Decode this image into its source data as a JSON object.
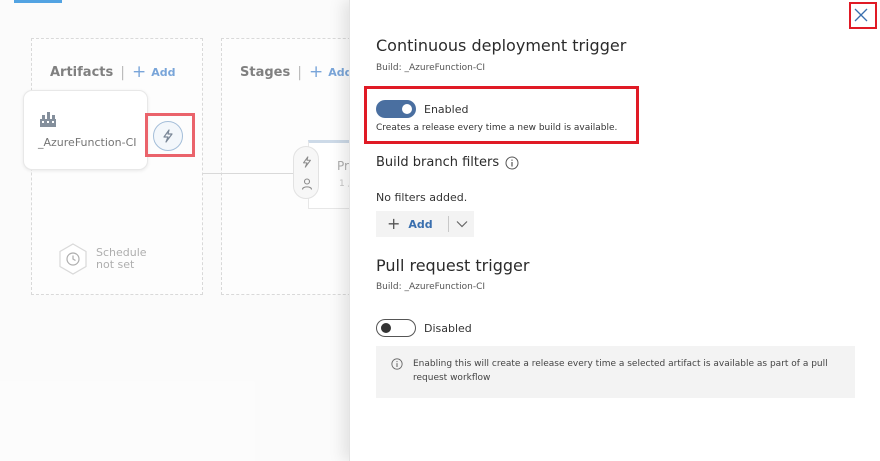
{
  "canvas": {
    "artifacts_label": "Artifacts",
    "add_label": "Add",
    "stages_label": "Stages",
    "stages_add_label": "Add",
    "artifact_name": "_AzureFunction-CI",
    "schedule_label_line1": "Schedule",
    "schedule_label_line2": "not set",
    "stage_name_partial": "Pr",
    "stage_sub_partial": "1 ,"
  },
  "panel": {
    "cd_title": "Continuous deployment trigger",
    "cd_build": "Build: _AzureFunction-CI",
    "cd_toggle_state": "on",
    "cd_toggle_label": "Enabled",
    "cd_description": "Creates a release every time a new build is available.",
    "branch_filters_title": "Build branch filters",
    "no_filters": "No filters added.",
    "add_button_label": "Add",
    "pr_title": "Pull request trigger",
    "pr_build": "Build: _AzureFunction-CI",
    "pr_toggle_state": "off",
    "pr_toggle_label": "Disabled",
    "pr_notice": "Enabling this will create a release every time a selected artifact is available as part of a pull request workflow"
  },
  "colors": {
    "accent": "#0078d4",
    "toggle_on": "#4a6fa0",
    "highlight": "#e01a25"
  },
  "icons": [
    "build-icon",
    "lightning-icon",
    "person-icon",
    "clock-icon",
    "info-icon",
    "close-icon",
    "chevron-down-icon",
    "plus-icon"
  ]
}
